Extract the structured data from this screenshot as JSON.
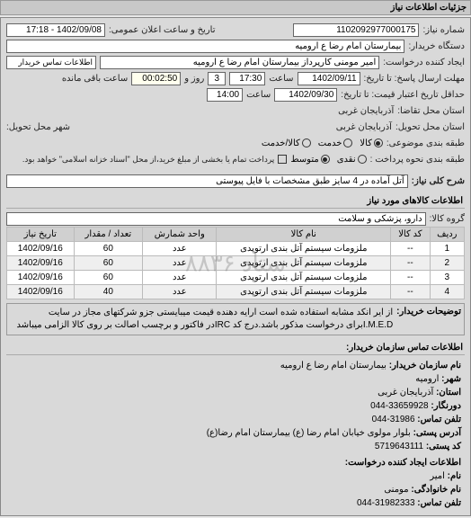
{
  "header": {
    "title": "جزئیات اطلاعات نیاز"
  },
  "form": {
    "reqno_label": "شماره نیاز:",
    "reqno": "1102092977000175",
    "announce_label": "تاریخ و ساعت اعلان عمومی:",
    "announce": "1402/09/08 - 17:18",
    "buyer_label": "دستگاه خریدار:",
    "buyer": "بیمارستان امام رضا  ع  ارومیه",
    "requester_label": "ایجاد کننده درخواست:",
    "requester": "امیر مومنی کارپرداز بیمارستان امام رضا  ع  ارومیه",
    "contact_link": "اطلاعات تماس خریدار",
    "deadline_label": "مهلت ارسال پاسخ: تا تاریخ:",
    "deadline_date": "1402/09/11",
    "time_label": "ساعت",
    "deadline_time": "17:30",
    "days_label": "روز و",
    "days": "3",
    "remain_label": "ساعت باقی مانده",
    "remain_time": "00:02:50",
    "validity_label": "حداقل تاریخ اعتبار قیمت: تا تاریخ:",
    "validity_date": "1402/09/30",
    "validity_time": "14:00",
    "province_req_label": "استان محل تقاضا:",
    "province_req": "آذربایجان غربی",
    "province_deliver_label": "استان محل تحویل:",
    "province_deliver": "آذربایجان غربی",
    "city_deliver_label": "شهر محل تحویل:",
    "class_label": "طبقه بندی موضوعی:",
    "class_opts": {
      "goods": "کالا",
      "service": "خدمت",
      "goods_service": "کالا/خدمت"
    },
    "pay_label": "طبقه بندی نحوه پرداخت :",
    "pay_opts": {
      "cash": "نقدی",
      "mid": "متوسط"
    },
    "pay_note": "پرداخت تمام یا بخشی از مبلغ خرید،از محل \"اسناد خزانه اسلامی\" خواهد بود.",
    "summary_label": "شرح کلی نیاز:",
    "summary": "آتل آماده در 4 سایز طبق مشخصات با فایل پیوستی",
    "items_title": "اطلاعات کالاهای مورد نیاز",
    "group_label": "گروه کالا:",
    "group": "دارو، پزشکی و سلامت"
  },
  "table": {
    "cols": {
      "row": "ردیف",
      "code": "کد کالا",
      "name": "نام کالا",
      "unit": "واحد شمارش",
      "qty": "تعداد / مقدار",
      "date": "تاریخ نیاز"
    },
    "rows": [
      {
        "row": "1",
        "code": "--",
        "name": "ملزومات سیستم آتل بندی ارتوپدی",
        "unit": "عدد",
        "qty": "60",
        "date": "1402/09/16"
      },
      {
        "row": "2",
        "code": "--",
        "name": "ملزومات سیستم آتل بندی ارتوپدی",
        "unit": "عدد",
        "qty": "60",
        "date": "1402/09/16"
      },
      {
        "row": "3",
        "code": "--",
        "name": "ملزومات سیستم آتل بندی ارتوپدی",
        "unit": "عدد",
        "qty": "60",
        "date": "1402/09/16"
      },
      {
        "row": "4",
        "code": "--",
        "name": "ملزومات سیستم آتل بندی ارتوپدی",
        "unit": "عدد",
        "qty": "40",
        "date": "1402/09/16"
      }
    ],
    "watermark": "ستاد\n۸۸۳۶"
  },
  "desc": {
    "label": "توضیحات خریدار:",
    "text": "از ایر انکد مشابه استفاده شده است ارایه دهنده قیمت میبایستی جزو شرکتهای مجاز در سایت I.M.E.Dبرای درخواست مذکور باشد.درج کد IRCدر فاکتور و برچسب اصالت بر روی کالا الزامی میباشد"
  },
  "buyer_info": {
    "title": "اطلاعات تماس سازمان خریدار:",
    "org_label": "نام سازمان خریدار:",
    "org": "بیمارستان امام رضا ع ارومیه",
    "city_label": "شهر:",
    "city": "ارومیه",
    "prov_label": "استان:",
    "prov": "آذربایجان غربی",
    "fax_label": "دورنگار:",
    "fax": "33659928-044",
    "phone_label": "تلفن تماس:",
    "phone": "31986-044",
    "addr_label": "آدرس پستی:",
    "addr": "بلوار مولوی خیابان امام رضا (ع) بیمارستان امام رضا(ع)",
    "zip_label": "کد پستی:",
    "zip": "5719643111",
    "creator_title": "اطلاعات ایجاد کننده درخواست:",
    "name_label": "نام:",
    "name": "امیر",
    "lname_label": "نام خانوادگی:",
    "lname": "مومنی",
    "cphone_label": "تلفن تماس:",
    "cphone": "31982333-044"
  }
}
